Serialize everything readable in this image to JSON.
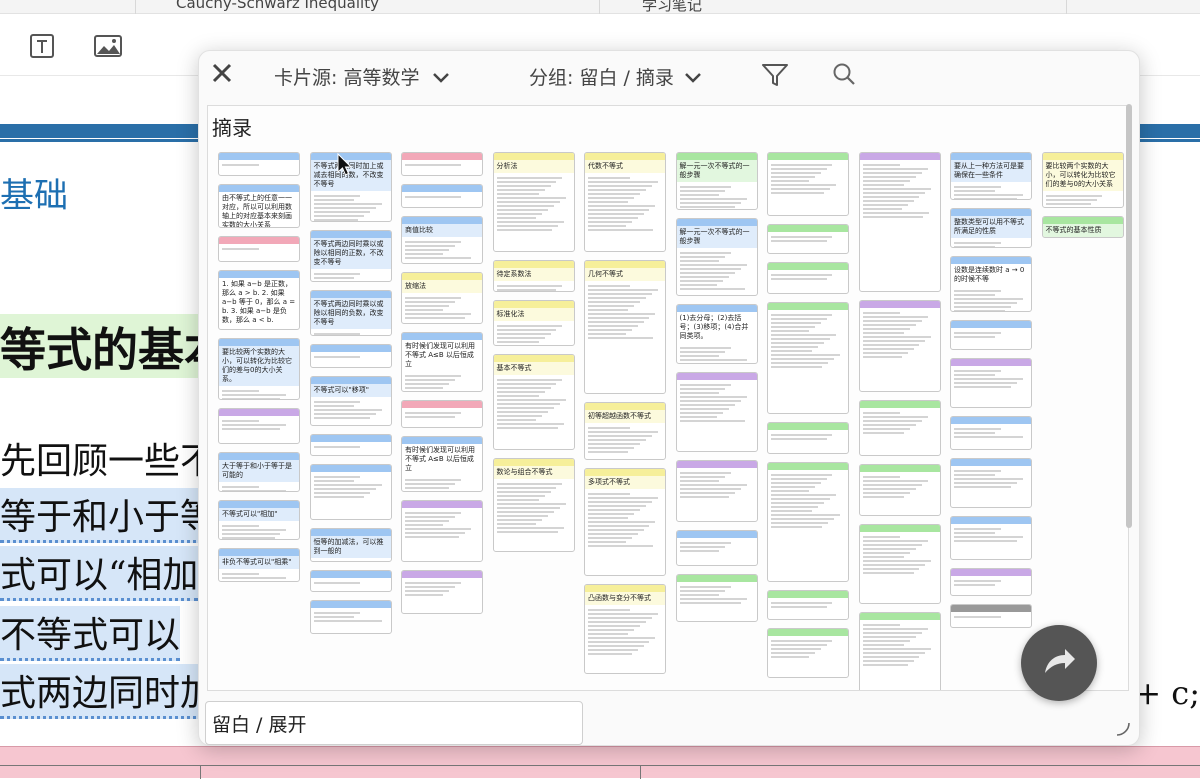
{
  "top_tabs": {
    "left": "Cauchy-Schwarz Inequality",
    "right": "学习笔记"
  },
  "toolbar": {
    "icons": [
      "text-box-icon",
      "image-icon"
    ]
  },
  "document": {
    "heading": "基础",
    "big_heading": "等式的基本",
    "lines": [
      "先回顾一些不",
      "等于和小于等",
      "式可以“相加",
      "不等式可以",
      "式两边同时加"
    ],
    "right_math": "+ c;"
  },
  "panel": {
    "source_label": "卡片源: 高等数学",
    "group_label": "分组: 留白 / 摘录",
    "board_title": "摘录",
    "footer_label": "留白 / 展开",
    "columns": [
      [
        {
          "title": "",
          "color": "#9ec6f2",
          "h": 24
        },
        {
          "title": "由不等式上的任意一一对应，所以可以利用数轴上的对应基本来刻画实数的大小关系",
          "color": "#ffffff",
          "h": 44
        },
        {
          "title": "",
          "color": "#f2a8b8",
          "h": 26
        },
        {
          "title": "1. 如果 a−b 是正数，那么 a > b.  2. 如果 a−b 等于 0，那么 a = b.  3. 如果 a−b 是负数，那么 a < b.",
          "color": "#ffffff",
          "h": 60
        },
        {
          "title": "要比较两个实数的大小，可以转化为比较它们的差与0的大小关系。",
          "color": "#9ec6f2",
          "h": 62
        },
        {
          "title": "",
          "color": "#c9a8e6",
          "h": 36
        },
        {
          "title": "大于等于和小于等于是可能的",
          "color": "#9ec6f2",
          "h": 40
        },
        {
          "title": "不等式可以\"相加\"",
          "color": "#9ec6f2",
          "h": 40
        },
        {
          "title": "非负不等式可以\"相乘\"",
          "color": "#9ec6f2",
          "h": 34
        }
      ],
      [
        {
          "title": "不等式两边同时加上或减去相同的数，不改变不等号",
          "color": "#9ec6f2",
          "h": 70
        },
        {
          "title": "不等式两边同时乘以或除以相同的正数，不改变不等号",
          "color": "#9ec6f2",
          "h": 52
        },
        {
          "title": "不等式两边同时乘以或除以相同的负数，改变不等号",
          "color": "#9ec6f2",
          "h": 46
        },
        {
          "title": "",
          "color": "#ffffff",
          "h": 24
        },
        {
          "title": "不等式可以\"移项\"",
          "color": "#9ec6f2",
          "h": 50
        },
        {
          "title": "",
          "color": "#9ec6f2",
          "h": 22
        },
        {
          "title": "",
          "color": "#9ec6f2",
          "h": 56
        },
        {
          "title": "恒等的加减法，可以推到一般的",
          "color": "#9ec6f2",
          "h": 34
        },
        {
          "title": "",
          "color": "#9ec6f2",
          "h": 22
        },
        {
          "title": "",
          "color": "#9ec6f2",
          "h": 34
        }
      ],
      [
        {
          "title": "",
          "color": "#f2a8b8",
          "h": 24
        },
        {
          "title": "",
          "color": "#9ec6f2",
          "h": 24
        },
        {
          "title": "商值比较",
          "color": "#9ec6f2",
          "h": 48
        },
        {
          "title": "放缩法",
          "color": "#f6ef9a",
          "h": 52
        },
        {
          "title": "有时候们发现可以利用不等式 A≤B 以后恒成立",
          "color": "#ffffff",
          "h": 60
        },
        {
          "title": "",
          "color": "#f2a8b8",
          "h": 28
        },
        {
          "title": "有时候们发现可以利用不等式 A≤B 以后恒成立",
          "color": "#ffffff",
          "h": 56
        },
        {
          "title": "",
          "color": "#c9a8e6",
          "h": 62
        },
        {
          "title": "",
          "color": "#c9a8e6",
          "h": 44
        }
      ],
      [
        {
          "title": "分析法",
          "color": "#f6ef9a",
          "h": 100
        },
        {
          "title": "待定系数法",
          "color": "#f6ef9a",
          "h": 32
        },
        {
          "title": "标准化法",
          "color": "#f6ef9a",
          "h": 46
        },
        {
          "title": "基本不等式",
          "color": "#f6ef9a",
          "h": 96
        },
        {
          "title": "数论与组合不等式",
          "color": "#f6ef9a",
          "h": 94
        }
      ],
      [
        {
          "title": "代数不等式",
          "color": "#f6ef9a",
          "h": 100
        },
        {
          "title": "几何不等式",
          "color": "#f6ef9a",
          "h": 134
        },
        {
          "title": "初等超越函数不等式",
          "color": "#f6ef9a",
          "h": 58
        },
        {
          "title": "多项式不等式",
          "color": "#f6ef9a",
          "h": 108
        },
        {
          "title": "凸函数与变分不等式",
          "color": "#f6ef9a",
          "h": 90
        }
      ],
      [
        {
          "title": "解一元一次不等式的一般步骤",
          "color": "#a8e6a0",
          "h": 58
        },
        {
          "title": "解一元一次不等式的一般步骤",
          "color": "#9ec6f2",
          "h": 78
        },
        {
          "title": "(1)去分母；(2)去括号；(3)移项；(4)合并同类项。",
          "color": "#ffffff",
          "h": 60
        },
        {
          "title": "",
          "color": "#c9a8e6",
          "h": 80
        },
        {
          "title": "",
          "color": "#c9a8e6",
          "h": 62
        },
        {
          "title": "",
          "color": "#9ec6f2",
          "h": 36
        },
        {
          "title": "",
          "color": "#a8e6a0",
          "h": 48
        }
      ],
      [
        {
          "title": "",
          "color": "#a8e6a0",
          "h": 64
        },
        {
          "title": "",
          "color": "#a8e6a0",
          "h": 30
        },
        {
          "title": "",
          "color": "#a8e6a0",
          "h": 32
        },
        {
          "title": "",
          "color": "#a8e6a0",
          "h": 112
        },
        {
          "title": "",
          "color": "#a8e6a0",
          "h": 32
        },
        {
          "title": "",
          "color": "#a8e6a0",
          "h": 120
        },
        {
          "title": "",
          "color": "#a8e6a0",
          "h": 30
        },
        {
          "title": "",
          "color": "#a8e6a0",
          "h": 50
        }
      ],
      [
        {
          "title": "",
          "color": "#c9a8e6",
          "h": 140
        },
        {
          "title": "",
          "color": "#c9a8e6",
          "h": 92
        },
        {
          "title": "",
          "color": "#a8e6a0",
          "h": 56
        },
        {
          "title": "",
          "color": "#a8e6a0",
          "h": 52
        },
        {
          "title": "",
          "color": "#a8e6a0",
          "h": 80
        },
        {
          "title": "",
          "color": "#a8e6a0",
          "h": 86
        }
      ],
      [
        {
          "title": "要从上一种方法可是要确保在一些条件",
          "color": "#9ec6f2",
          "h": 48
        },
        {
          "title": "整数类型可以用不等式所满足的性质",
          "color": "#9ec6f2",
          "h": 40
        },
        {
          "title": "设数是连续数时 a → 0 的时候不等",
          "color": "#ffffff",
          "h": 56
        },
        {
          "title": "",
          "color": "#9ec6f2",
          "h": 30
        },
        {
          "title": "",
          "color": "#c9a8e6",
          "h": 50
        },
        {
          "title": "",
          "color": "#9ec6f2",
          "h": 34
        },
        {
          "title": "",
          "color": "#9ec6f2",
          "h": 50
        },
        {
          "title": "",
          "color": "#9ec6f2",
          "h": 44
        },
        {
          "title": "",
          "color": "#c9a8e6",
          "h": 28
        },
        {
          "title": "",
          "color": "#999999",
          "h": 24
        }
      ],
      [
        {
          "title": "要比较两个实数的大小，可以转化为比较它们的差与0的大小关系",
          "color": "#f6ef9a",
          "h": 56
        },
        {
          "title": "不等式的基本性质",
          "color": "#a8e6a0",
          "h": 22
        }
      ]
    ]
  }
}
